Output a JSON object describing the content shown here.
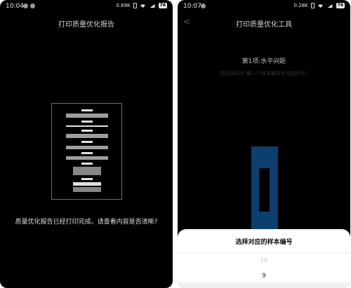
{
  "left_screen": {
    "status": {
      "time": "10:04",
      "speed": "0.69K",
      "battery": "76"
    },
    "title": "打印质量优化报告",
    "prompt": "质量优化报告已经打印完成。请查看内容是否清晰?"
  },
  "right_screen": {
    "status": {
      "time": "10:07",
      "speed": "0.28K",
      "battery": "76"
    },
    "back_icon": "<",
    "title": "打印质量优化工具",
    "step_label": "第1项:水平间距",
    "hint": "找到条码中,哪一个样本最符合左图所示?",
    "sheet": {
      "title": "选择对应的样本编号",
      "options": [
        "10",
        "9"
      ]
    }
  },
  "colors": {
    "background": "#000000",
    "sample_blue": "#0c3f6d",
    "sheet": "#ffffff"
  },
  "icons": [
    "status-dot-icon",
    "vibrate-icon",
    "wifi-icon",
    "signal-icon",
    "battery-icon",
    "back-arrow-icon"
  ]
}
